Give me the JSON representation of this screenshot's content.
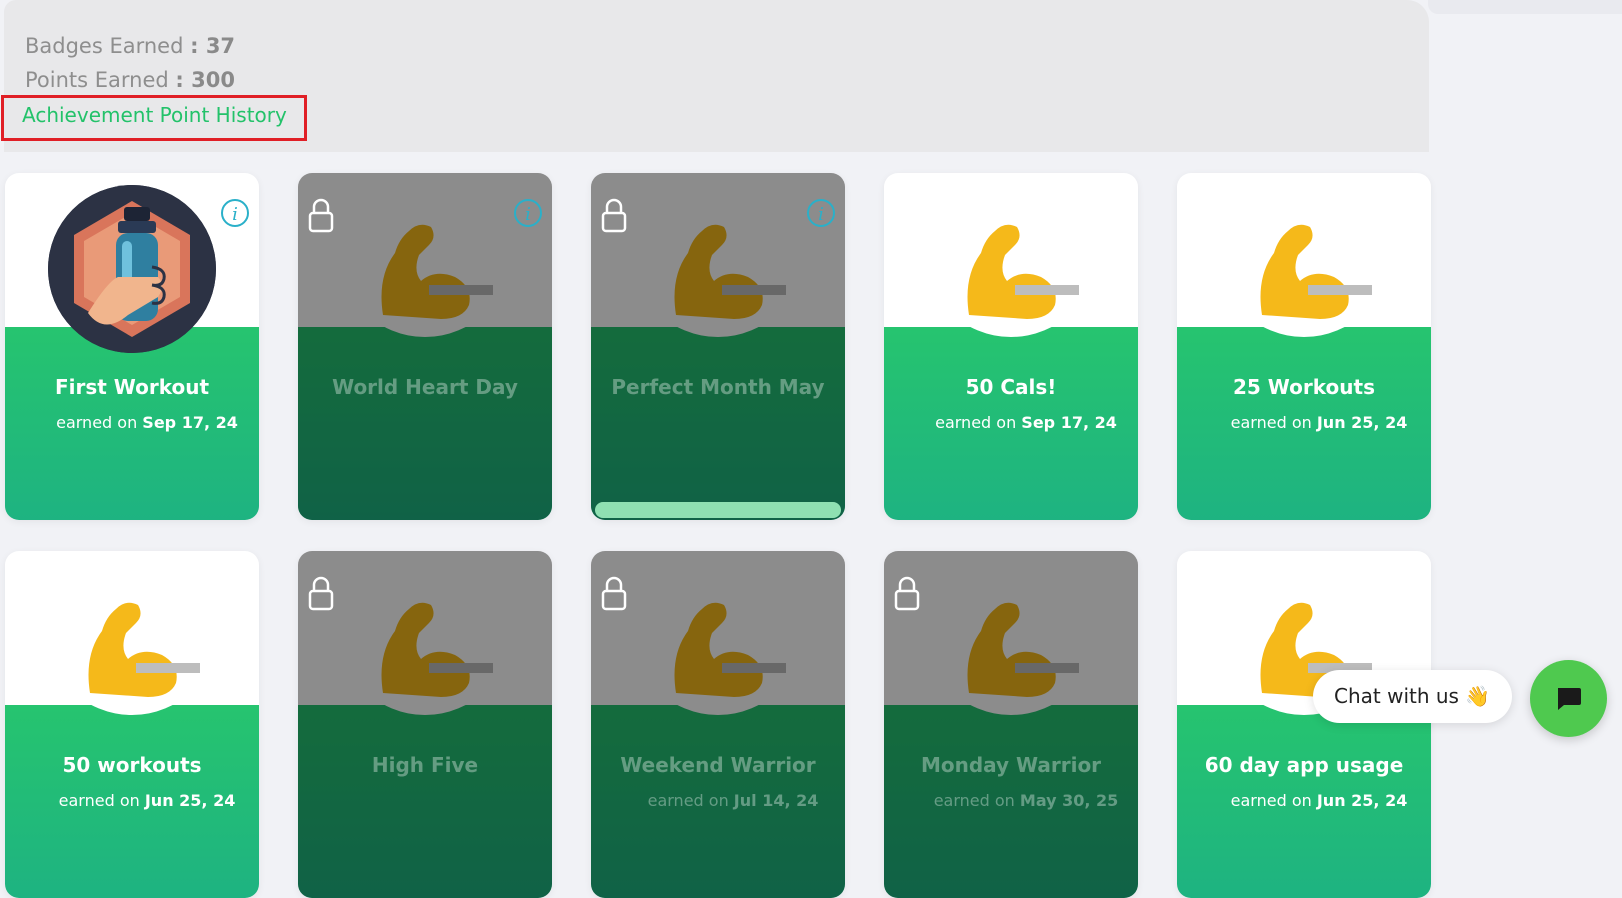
{
  "summary": {
    "badges_label": "Badges Earned ",
    "badges_value": ": 37",
    "points_label": "Points Earned ",
    "points_value": ": 300",
    "history_link": "Achievement Point History"
  },
  "cards": [
    {
      "title": "First Workout",
      "earned_prefix": "earned on ",
      "earned_date": "Sep 17, 24",
      "icon": "water-bottle",
      "locked": false
    },
    {
      "title": "World Heart Day",
      "earned_prefix": "",
      "earned_date": "",
      "icon": "flexed-biceps",
      "locked": true
    },
    {
      "title": "Perfect Month May",
      "earned_prefix": "",
      "earned_date": "",
      "icon": "flexed-biceps",
      "locked": true,
      "progress": 1.0
    },
    {
      "title": "50 Cals!",
      "earned_prefix": "earned on ",
      "earned_date": "Sep 17, 24",
      "icon": "flexed-biceps",
      "locked": false
    },
    {
      "title": "25 Workouts",
      "earned_prefix": "earned on ",
      "earned_date": "Jun 25, 24",
      "icon": "flexed-biceps",
      "locked": false
    },
    {
      "title": "50 workouts",
      "earned_prefix": "earned on ",
      "earned_date": "Jun 25, 24",
      "icon": "flexed-biceps",
      "locked": false
    },
    {
      "title": "High Five",
      "earned_prefix": "",
      "earned_date": "",
      "icon": "flexed-biceps",
      "locked": true
    },
    {
      "title": "Weekend Warrior",
      "earned_prefix": "earned on ",
      "earned_date": "Jul 14, 24",
      "icon": "flexed-biceps",
      "locked": true
    },
    {
      "title": "Monday Warrior",
      "earned_prefix": "earned on ",
      "earned_date": "May 30, 25",
      "icon": "flexed-biceps",
      "locked": true
    },
    {
      "title": "60 day app usage",
      "earned_prefix": "earned on ",
      "earned_date": "Jun 25, 24",
      "icon": "flexed-biceps",
      "locked": false
    }
  ],
  "chat": {
    "label": "Chat with us 👋"
  },
  "colors": {
    "accent_green": "#23c26a",
    "highlight_red": "#e01f26",
    "info_blue": "#2ab0c9",
    "chat_green": "#4fc94f"
  }
}
